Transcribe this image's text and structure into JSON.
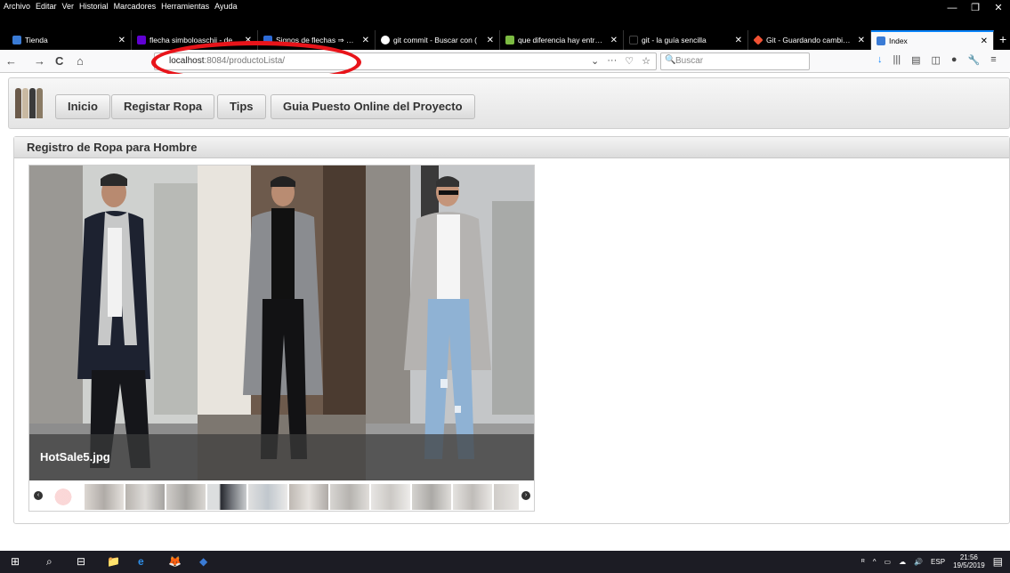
{
  "menubar": {
    "items": [
      "Archivo",
      "Editar",
      "Ver",
      "Historial",
      "Marcadores",
      "Herramientas",
      "Ayuda"
    ]
  },
  "window_controls": {
    "minimize": "—",
    "restore": "❐",
    "close": "✕"
  },
  "tabs": [
    {
      "label": "Tienda",
      "close": "✕",
      "color": "#3a7bd5"
    },
    {
      "label": "flecha simboloaschii - de",
      "close": "✕",
      "color": "#6001d2"
    },
    {
      "label": "Signos de flechas ⇒ (ha:",
      "close": "✕",
      "color": "#2e6bd6"
    },
    {
      "label": "git commit - Buscar con (",
      "close": "✕",
      "color": "#ffffff"
    },
    {
      "label": "que diferencia hay entre g",
      "close": "✕",
      "color": "#7cbb42"
    },
    {
      "label": "git - la guía sencilla",
      "close": "✕",
      "color": "#000000"
    },
    {
      "label": "Git - Guardando cambios",
      "close": "✕",
      "color": "#f05133"
    },
    {
      "label": "Index",
      "close": "✕",
      "color": "#3a7bd5",
      "active": true
    }
  ],
  "new_tab": "+",
  "navigation": {
    "back": "←",
    "forward": "→",
    "reload": "C",
    "home": "⌂",
    "url_host": "localhost",
    "url_rest": ":8084/productoLista/",
    "page_actions": [
      "⌄",
      "···",
      "♡",
      "☆"
    ],
    "search_icon": "🔍",
    "search_placeholder": "Buscar",
    "toolbar_icons": [
      "↓",
      "|||",
      "▤",
      "◫",
      "●",
      "🔧",
      "≡"
    ]
  },
  "app": {
    "nav_buttons": [
      "Inicio",
      "Registar Ropa",
      "Tips",
      "Guia Puesto Online del Proyecto"
    ],
    "panel_title": "Registro de Ropa para Hombre",
    "gallery": {
      "caption": "HotSale5.jpg",
      "prev": "‹",
      "next": "›",
      "thumbnail_count": 12,
      "selected_thumbnail": 4
    }
  },
  "taskbar": {
    "start": "⊞",
    "search": "⌕",
    "taskview": "⊟",
    "apps": [
      "📁",
      "e",
      "🦊",
      "◆"
    ],
    "tray": [
      "ᴿ",
      "^",
      "▭",
      "☁",
      "🔊"
    ],
    "language": "ESP",
    "time": "21:56",
    "date": "19/5/2019",
    "notify": "▤"
  },
  "colors": {
    "annotation_circle": "#e8141a",
    "active_tab_accent": "#0a84ff",
    "taskbar": "#1c1c24"
  }
}
